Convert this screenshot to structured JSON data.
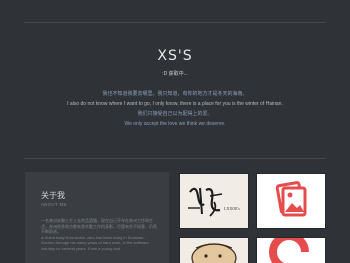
{
  "hero": {
    "title": "XS'S",
    "status": ":D 获取中...",
    "lines": [
      "我也不知道我要去哪里。我只知道，有你的地方才是冬天的海南。",
      "I also do not know where I want to go, I only know, there is a place for you is the winter of Hainan.",
      "我们只接受自己以为配得上的爱。",
      "We only accept the love we think we deserve."
    ]
  },
  "about": {
    "title": "关于我",
    "subtitle": "ABOUT ME",
    "text": "一名来自安徽土生土长的品酒猫，现在自己开车在苏州工作和生活，苏州很多地方都有我辛勤工作的身影。尽管有些不如意，仍然不断前进。",
    "text_en": "A Shent baby from Anhui, who has been living in Kunshan, Suzhou through his many years of hard work, in the software industry for several years. Even a young and"
  },
  "gallery": {
    "logo_text": "XSSHOU",
    "logo_label": "LXXOE's"
  },
  "colors": {
    "background": "#2f3236",
    "card": "#3a3e43",
    "accent_red": "#e74c4c",
    "accent_blue": "#8aa0b8"
  },
  "icons": [
    "image-placeholder-icon",
    "calligraphy-logo",
    "cartoon-thumbnail",
    "red-letter-logo"
  ]
}
